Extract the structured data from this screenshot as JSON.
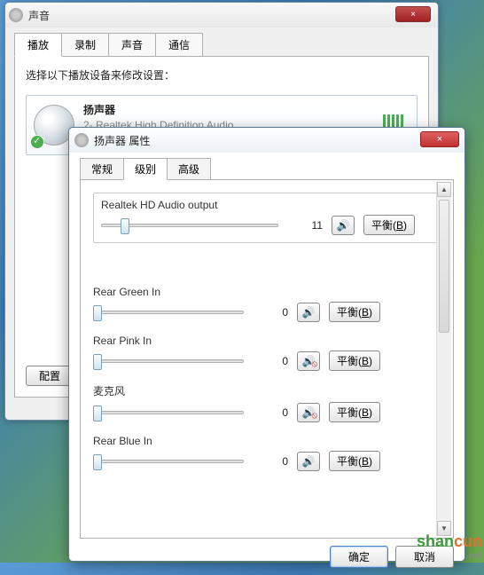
{
  "win1": {
    "title": "声音",
    "close_x": "×",
    "tabs": [
      "播放",
      "录制",
      "声音",
      "通信"
    ],
    "instruction": "选择以下播放设备来修改设置：",
    "device": {
      "name": "扬声器",
      "desc": "2- Realtek High Definition Audio",
      "status": "默认设备"
    },
    "config_btn": "配置"
  },
  "win2": {
    "title": "扬声器 属性",
    "close_x": "×",
    "tabs": [
      "常规",
      "级别",
      "高级"
    ],
    "controls": [
      {
        "label": "Realtek HD Audio output",
        "value": "11",
        "pos": 11,
        "muted": false,
        "framed": true
      },
      {
        "label": "Rear Green In",
        "value": "0",
        "pos": 0,
        "muted": false,
        "framed": false
      },
      {
        "label": "Rear Pink In",
        "value": "0",
        "pos": 0,
        "muted": true,
        "framed": false
      },
      {
        "label": "麦克风",
        "value": "0",
        "pos": 0,
        "muted": true,
        "framed": false
      },
      {
        "label": "Rear Blue In",
        "value": "0",
        "pos": 0,
        "muted": false,
        "framed": false
      }
    ],
    "balance_label": "平衡(",
    "balance_key": "B",
    "balance_close": ")",
    "speaker_glyph": "🔊",
    "ok": "确定",
    "cancel": "取消"
  },
  "watermark": {
    "text1": "shan",
    "text2": "cun",
    "sub": ".net"
  }
}
